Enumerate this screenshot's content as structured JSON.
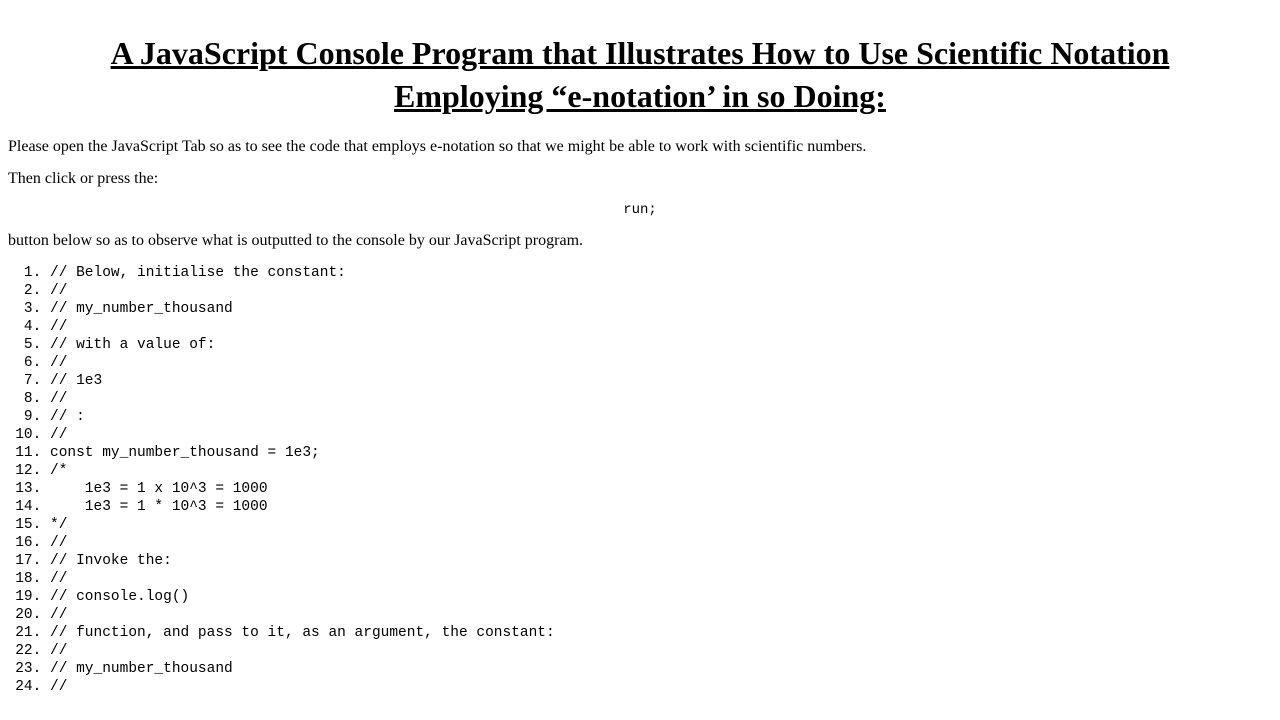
{
  "title": "A JavaScript Console Program that Illustrates How to Use Scientific Notation Employing “e-notation’ in so Doing:",
  "paragraphs": {
    "p1": "Please open the JavaScript Tab so as to see the code that employs e-notation so that we might be able to work with scientific numbers.",
    "p2": "Then click or press the:",
    "p3": "button below so as to observe what is outputted to the console by our JavaScript program."
  },
  "run_label": "run;",
  "code_lines": [
    "// Below, initialise the constant:",
    "//",
    "// my_number_thousand",
    "//",
    "// with a value of:",
    "//",
    "// 1e3",
    "//",
    "// :",
    "//",
    "const my_number_thousand = 1e3;",
    "/*",
    "    1e3 = 1 x 10^3 = 1000",
    "    1e3 = 1 * 10^3 = 1000",
    "*/",
    "//",
    "// Invoke the:",
    "//",
    "// console.log()",
    "//",
    "// function, and pass to it, as an argument, the constant:",
    "//",
    "// my_number_thousand",
    "//"
  ]
}
